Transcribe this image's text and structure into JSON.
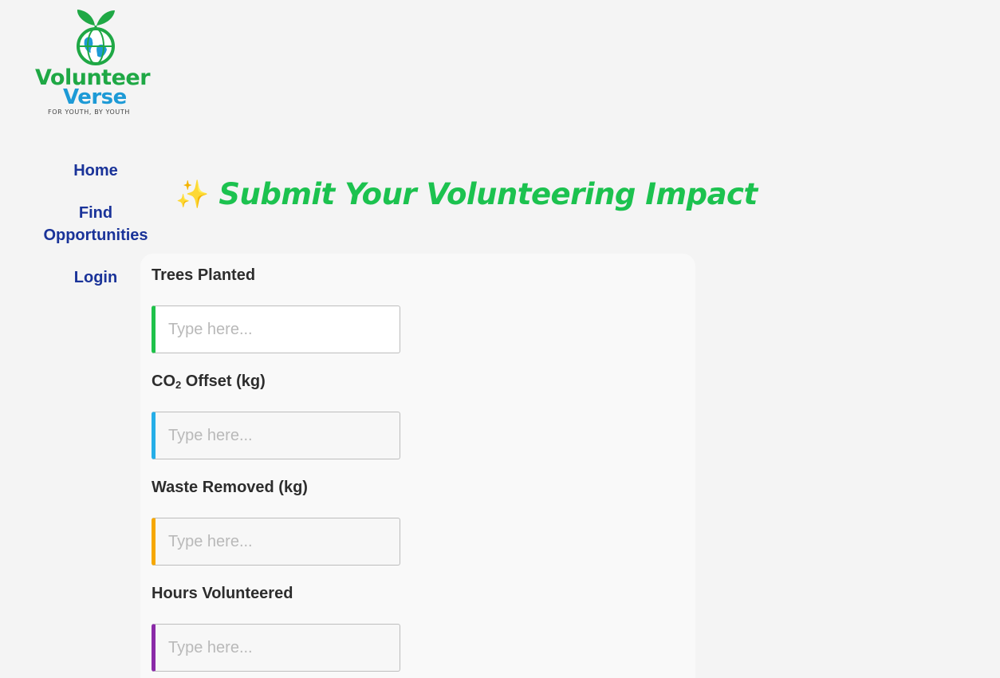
{
  "brand": {
    "name_line1": "Volunteer",
    "name_line2": "Verse",
    "tagline": "FOR YOUTH, BY YOUTH"
  },
  "nav": {
    "home": "Home",
    "find_opportunities": "Find Opportunities",
    "login": "Login"
  },
  "page": {
    "title_icon": "✨",
    "title": "Submit Your Volunteering Impact"
  },
  "form": {
    "fields": [
      {
        "label": "Trees Planted",
        "placeholder": "Type here...",
        "value": ""
      },
      {
        "label_prefix": "CO",
        "label_sub": "2",
        "label_suffix": " Offset (kg)",
        "placeholder": "Type here...",
        "value": ""
      },
      {
        "label": "Waste Removed (kg)",
        "placeholder": "Type here...",
        "value": ""
      },
      {
        "label": "Hours Volunteered",
        "placeholder": "Type here...",
        "value": ""
      }
    ]
  },
  "colors": {
    "title_green": "#1cc24f",
    "nav_blue": "#1a3399",
    "accent_green": "#1fc24a",
    "accent_blue": "#25aee8",
    "accent_orange": "#f6a800",
    "accent_purple": "#8a2aa8"
  }
}
